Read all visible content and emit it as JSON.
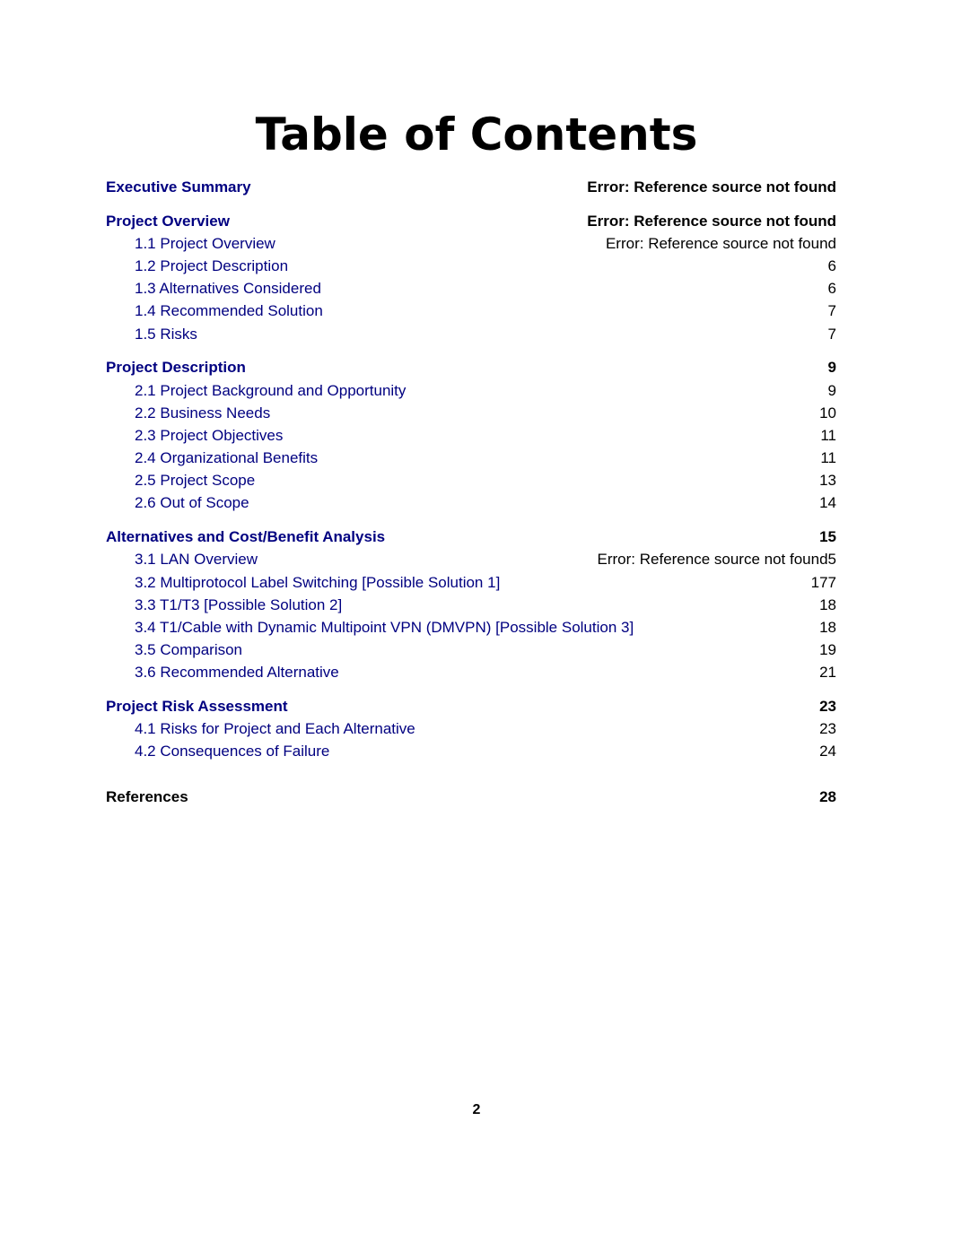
{
  "document": {
    "title": "Table of Contents",
    "page_number": "2",
    "colors": {
      "link": "#000080",
      "text": "#000000"
    }
  },
  "toc": [
    {
      "level": 1,
      "label": "Executive Summary",
      "page": "Error: Reference source not found"
    },
    {
      "level": 1,
      "label": "Project Overview",
      "page": "Error: Reference source not found"
    },
    {
      "level": 2,
      "label": "1.1 Project Overview",
      "page": "Error: Reference source not found"
    },
    {
      "level": 2,
      "label": "1.2 Project Description",
      "page": "6"
    },
    {
      "level": 2,
      "label": "1.3 Alternatives Considered",
      "page": "6"
    },
    {
      "level": 2,
      "label": "1.4 Recommended Solution",
      "page": "7"
    },
    {
      "level": 2,
      "label": "1.5 Risks",
      "page": "7"
    },
    {
      "level": 1,
      "label": "Project Description",
      "page": "9"
    },
    {
      "level": 2,
      "label": "2.1 Project Background and Opportunity",
      "page": "9"
    },
    {
      "level": 2,
      "label": "2.2 Business Needs",
      "page": "10"
    },
    {
      "level": 2,
      "label": "2.3 Project Objectives",
      "page": "11"
    },
    {
      "level": 2,
      "label": "2.4 Organizational Benefits",
      "page": "11"
    },
    {
      "level": 2,
      "label": "2.5 Project Scope",
      "page": "13"
    },
    {
      "level": 2,
      "label": "2.6 Out of Scope",
      "page": "14"
    },
    {
      "level": 1,
      "label": "Alternatives and Cost/Benefit Analysis",
      "page": "15"
    },
    {
      "level": 2,
      "label": "3.1 LAN Overview",
      "page": "Error: Reference source not found5"
    },
    {
      "level": 2,
      "label": "3.2 Multiprotocol Label Switching [Possible Solution 1]",
      "page": "177"
    },
    {
      "level": 2,
      "label": "3.3 T1/T3 [Possible Solution 2]",
      "page": "18"
    },
    {
      "level": 2,
      "label": "3.4 T1/Cable with Dynamic Multipoint VPN (DMVPN) [Possible Solution 3]",
      "page": "18"
    },
    {
      "level": 2,
      "label": "3.5 Comparison",
      "page": "19"
    },
    {
      "level": 2,
      "label": "3.6 Recommended Alternative",
      "page": "21"
    },
    {
      "level": 1,
      "label": "Project Risk Assessment",
      "page": "23"
    },
    {
      "level": 2,
      "label": "4.1 Risks for Project and Each Alternative",
      "page": "23"
    },
    {
      "level": 2,
      "label": "4.2 Consequences of Failure",
      "page": "24"
    },
    {
      "level": 1,
      "label": "References",
      "page": "28",
      "plain": true
    }
  ]
}
